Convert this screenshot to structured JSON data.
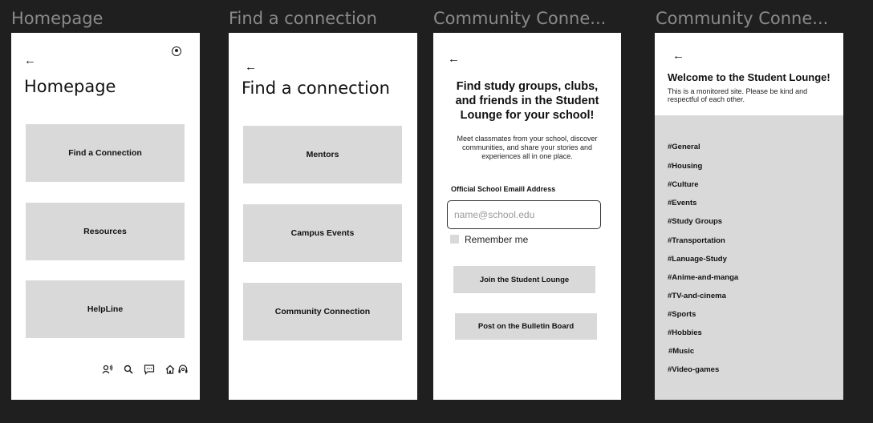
{
  "frames": {
    "homepage": {
      "frame_title": "Homepage",
      "back": "←",
      "heading": "Homepage",
      "items": [
        "Find a Connection",
        "Resources",
        "HelpLine"
      ],
      "bottom_nav": [
        "voice-icon",
        "search-icon",
        "chat-icon",
        "home-icon",
        "support-icon"
      ]
    },
    "find_connection": {
      "frame_title": "Find a connection",
      "back": "←",
      "heading": "Find a connection",
      "items": [
        "Mentors",
        "Campus Events",
        "Community Connection"
      ]
    },
    "community_signup": {
      "frame_title": "Community Conne...",
      "back": "←",
      "headline": "Find study groups, clubs, and friends in the Student Lounge for your school!",
      "subtext": "Meet classmates from your school, discover communities, and share your stories and experiences all in one place.",
      "email_label": "Official School Emaill Address",
      "email_placeholder": "name@school.edu",
      "remember_label": "Remember me",
      "join_button": "Join the Student Lounge",
      "post_button": "Post on the Bulletin Board"
    },
    "student_lounge": {
      "frame_title": "Community Conne...",
      "back": "←",
      "title": "Welcome to the Student Lounge!",
      "description": "This is a monitored site. Please be kind and respectful of each other.",
      "channels": [
        "#General",
        "#Housing",
        "#Culture",
        "#Events",
        "#Study Groups",
        "#Transportation",
        "#Lanuage-Study",
        "#Anime-and-manga",
        "#TV-and-cinema",
        "#Sports",
        "#Hobbies",
        "#Music",
        "#Video-games"
      ]
    }
  },
  "colors": {
    "background": "#1f1f1f",
    "frame": "#ffffff",
    "placeholder_fill": "#d9d9d9",
    "frame_title": "#8a8a8a"
  }
}
